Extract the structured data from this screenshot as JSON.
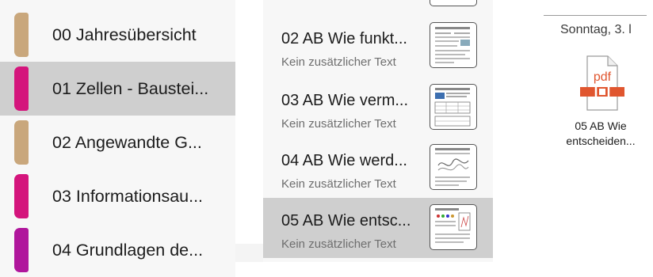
{
  "sections": [
    {
      "label": "00 Jahresübersicht",
      "color": "#c9a77c",
      "selected": false
    },
    {
      "label": "01 Zellen - Baustei...",
      "color": "#d4157c",
      "selected": true
    },
    {
      "label": "02 Angewandte G...",
      "color": "#c9a77c",
      "selected": false
    },
    {
      "label": "03 Informationsau...",
      "color": "#d4157c",
      "selected": false
    },
    {
      "label": "04 Grundlagen de...",
      "color": "#b0169c",
      "selected": false
    }
  ],
  "pages": [
    {
      "title": "02 AB Wie funkt...",
      "subtitle": "Kein zusätzlicher Text",
      "thumbnail": "worksheet-thumbnail",
      "selected": false
    },
    {
      "title": "03 AB Wie verm...",
      "subtitle": "Kein zusätzlicher Text",
      "thumbnail": "worksheet-thumbnail",
      "selected": false
    },
    {
      "title": "04 AB Wie werd...",
      "subtitle": "Kein zusätzlicher Text",
      "thumbnail": "worksheet-thumbnail",
      "selected": false
    },
    {
      "title": "05 AB Wie entsc...",
      "subtitle": "Kein zusätzlicher Text",
      "thumbnail": "worksheet-thumbnail",
      "selected": true
    }
  ],
  "canvas": {
    "date": "Sonntag, 3. l",
    "attachment": {
      "icon": "pdf-file-icon",
      "badge_text": "pdf",
      "badge_color": "#e0562f",
      "label_line1": "05 AB Wie",
      "label_line2": "entscheiden..."
    }
  }
}
